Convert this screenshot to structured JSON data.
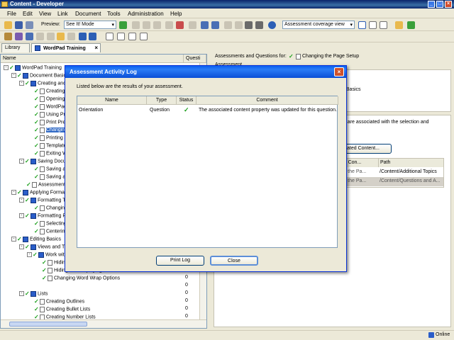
{
  "window": {
    "title": "Content - Developer"
  },
  "menu": [
    "File",
    "Edit",
    "View",
    "Link",
    "Document",
    "Tools",
    "Administration",
    "Help"
  ],
  "toolbar": {
    "preview_label": "Preview:",
    "preview_mode": "See It! Mode",
    "view_select": "Assessment coverage view"
  },
  "tabs": {
    "library": "Library",
    "doc": "WordPad Training"
  },
  "leftpane": {
    "col_name": "Name",
    "col_quest": "Questi",
    "rows": [
      {
        "label": "WordPad Training",
        "count": "",
        "indent": 0,
        "expander": "-",
        "icon": "book"
      },
      {
        "label": "Document Basics",
        "count": "",
        "indent": 1,
        "expander": "-",
        "icon": "book"
      },
      {
        "label": "Creating and",
        "count": "",
        "indent": 2,
        "expander": "-",
        "icon": "book"
      },
      {
        "label": "Creating",
        "count": "",
        "indent": 3,
        "expander": "",
        "icon": "page"
      },
      {
        "label": "Opening",
        "count": "",
        "indent": 3,
        "expander": "",
        "icon": "page"
      },
      {
        "label": "WordPad",
        "count": "",
        "indent": 3,
        "expander": "",
        "icon": "page"
      },
      {
        "label": "Using Pri",
        "count": "",
        "indent": 3,
        "expander": "",
        "icon": "page"
      },
      {
        "label": "Print Pre",
        "count": "",
        "indent": 3,
        "expander": "",
        "icon": "page"
      },
      {
        "label": "Changing",
        "count": "",
        "indent": 3,
        "expander": "",
        "icon": "page"
      },
      {
        "label": "Printing a",
        "count": "",
        "indent": 3,
        "expander": "",
        "icon": "page"
      },
      {
        "label": "Template",
        "count": "",
        "indent": 3,
        "expander": "",
        "icon": "page"
      },
      {
        "label": "Exiting W",
        "count": "",
        "indent": 3,
        "expander": "",
        "icon": "page"
      },
      {
        "label": "Saving Docu",
        "count": "",
        "indent": 2,
        "expander": "-",
        "icon": "book"
      },
      {
        "label": "Saving a",
        "count": "",
        "indent": 3,
        "expander": "",
        "icon": "page"
      },
      {
        "label": "Saving a",
        "count": "",
        "indent": 3,
        "expander": "",
        "icon": "page"
      },
      {
        "label": "Assessment",
        "count": "",
        "indent": 2,
        "expander": "",
        "icon": "page"
      },
      {
        "label": "Applying Formatt",
        "count": "",
        "indent": 1,
        "expander": "-",
        "icon": "book"
      },
      {
        "label": "Formatting T",
        "count": "",
        "indent": 2,
        "expander": "-",
        "icon": "book"
      },
      {
        "label": "Changing",
        "count": "",
        "indent": 3,
        "expander": "",
        "icon": "page"
      },
      {
        "label": "Formatting P",
        "count": "",
        "indent": 2,
        "expander": "-",
        "icon": "book"
      },
      {
        "label": "Selecting",
        "count": "",
        "indent": 3,
        "expander": "",
        "icon": "page"
      },
      {
        "label": "Centering",
        "count": "",
        "indent": 3,
        "expander": "",
        "icon": "page"
      },
      {
        "label": "Editing Basics",
        "count": "",
        "indent": 1,
        "expander": "-",
        "icon": "book"
      },
      {
        "label": "Views and Tr",
        "count": "",
        "indent": 2,
        "expander": "-",
        "icon": "book"
      },
      {
        "label": "Work with",
        "count": "",
        "indent": 3,
        "expander": "-",
        "icon": "book"
      },
      {
        "label": "Hidin",
        "count": "",
        "indent": 4,
        "expander": "",
        "icon": "page"
      },
      {
        "label": "Hiding and Displaying the Status Bar",
        "count": "0",
        "indent": 4,
        "expander": "",
        "icon": "page"
      },
      {
        "label": "Changing Word Wrap Options",
        "count": "0",
        "indent": 4,
        "expander": "",
        "icon": "page"
      },
      {
        "label": "",
        "count": "0",
        "indent": 4,
        "expander": "",
        "icon": "none"
      },
      {
        "label": "Lists",
        "count": "0",
        "indent": 2,
        "expander": "-",
        "icon": "book"
      },
      {
        "label": "Creating Outlines",
        "count": "0",
        "indent": 3,
        "expander": "",
        "icon": "page"
      },
      {
        "label": "Creating Bullet Lists",
        "count": "0",
        "indent": 3,
        "expander": "",
        "icon": "page"
      },
      {
        "label": "Creating Number Lists",
        "count": "0",
        "indent": 3,
        "expander": "",
        "icon": "page"
      }
    ]
  },
  "rightpane": {
    "header": "Assessments and Questions for:",
    "topic": "Changing the Page Setup",
    "section": "Assessment",
    "frag1": "t Basics",
    "frag2": "at are associated with the selection and",
    "button": "ated Content...",
    "table_head": [
      "ated Con...",
      "Path"
    ],
    "rows": [
      {
        "a": "ging the Pa...",
        "b": "/Content/Additional Topics"
      },
      {
        "a": "ging the Pa...",
        "b": "/Content/Questions and A..."
      }
    ]
  },
  "dialog": {
    "title": "Assessment Activity Log",
    "intro": "Listed below are the results of your assessment.",
    "columns": [
      "Name",
      "Type",
      "Status",
      "Comment"
    ],
    "rows": [
      {
        "name": "Orientation",
        "type": "Question",
        "status": "✓",
        "comment": "The associated content property was updated for this question."
      }
    ],
    "print_button": "Print Log",
    "close_button": "Close"
  },
  "status": {
    "online": "Online"
  },
  "colors": {
    "accent": "#0a5ff0",
    "check": "#1a9e1a"
  }
}
